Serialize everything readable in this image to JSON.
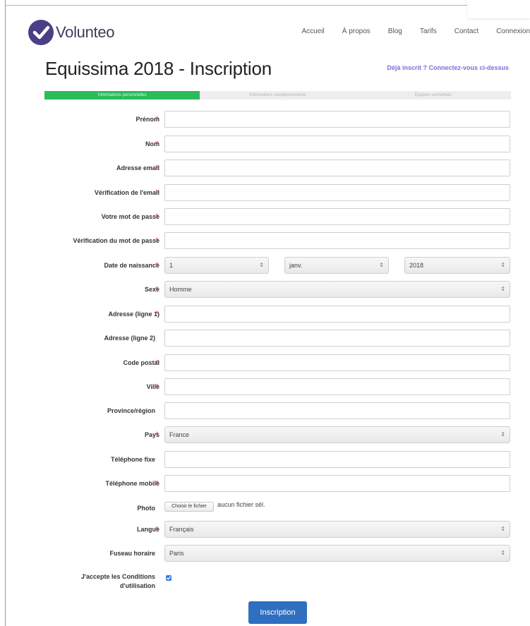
{
  "header": {
    "brand": "Volunteo",
    "nav": [
      "Accueil",
      "À propos",
      "Blog",
      "Tarifs",
      "Contact",
      "Connexion"
    ]
  },
  "page": {
    "title": "Equissima 2018 - Inscription",
    "login_link": "Déjà inscrit ? Connectez-vous ci-dessus"
  },
  "steps": [
    {
      "label": "Informations personnelles",
      "active": true
    },
    {
      "label": "Informations complémentaires",
      "active": false
    },
    {
      "label": "Équipes souhaitées",
      "active": false
    }
  ],
  "form": {
    "prenom": {
      "label": "Prénom",
      "value": "",
      "required": true
    },
    "nom": {
      "label": "Nom",
      "value": "",
      "required": true
    },
    "email": {
      "label": "Adresse email",
      "value": "",
      "required": true
    },
    "email_check": {
      "label": "Vérification de l'email",
      "value": "",
      "required": true
    },
    "password": {
      "label": "Votre mot de passe",
      "value": "",
      "required": true
    },
    "password_check": {
      "label": "Vérification du mot de passe",
      "value": "",
      "required": true
    },
    "birth": {
      "label": "Date de naissance",
      "required": true,
      "day": "1",
      "month": "janv.",
      "year": "2018"
    },
    "sexe": {
      "label": "Sexe",
      "value": "Homme",
      "required": true
    },
    "address1": {
      "label": "Adresse (ligne 1)",
      "value": "",
      "required": true
    },
    "address2": {
      "label": "Adresse (ligne 2)",
      "value": "",
      "required": false
    },
    "postal": {
      "label": "Code postal",
      "value": "",
      "required": true
    },
    "ville": {
      "label": "Ville",
      "value": "",
      "required": true
    },
    "province": {
      "label": "Province/région",
      "value": "",
      "required": false
    },
    "pays": {
      "label": "Pays",
      "value": "France",
      "required": true
    },
    "tel_fixe": {
      "label": "Téléphone fixe",
      "value": "",
      "required": false
    },
    "tel_mobile": {
      "label": "Téléphone mobile",
      "value": "",
      "required": true
    },
    "photo": {
      "label": "Photo",
      "button": "Choisir le fichier",
      "status": "aucun fichier sél."
    },
    "langue": {
      "label": "Langue",
      "value": "Français",
      "required": true
    },
    "fuseau": {
      "label": "Fuseau horaire",
      "value": "Paris",
      "required": false
    },
    "cgu": {
      "label_line1": "J'accepte les Conditions",
      "label_line2": "d'utilisation",
      "checked": true
    },
    "required_mark": "*",
    "select_arrows": "⇕"
  },
  "submit": {
    "label": "Inscription"
  },
  "colors": {
    "accent": "#2bbb5a",
    "primary_button": "#2f6fbf",
    "link": "#7d6fd6",
    "required": "#e05050",
    "brand": "#4a3f86"
  }
}
